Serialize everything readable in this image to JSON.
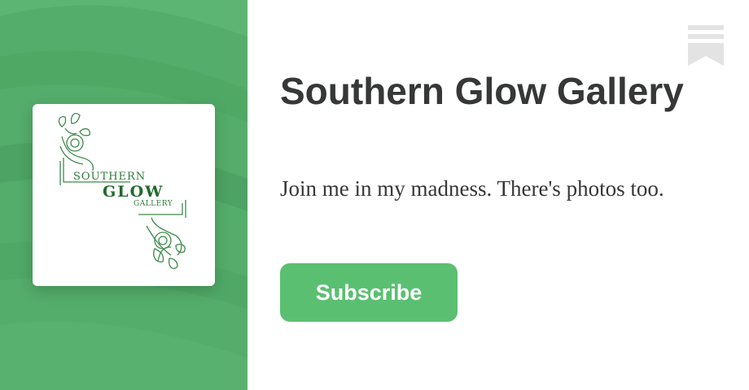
{
  "publication": {
    "title": "Southern Glow Gallery",
    "description": "Join me in my madness. There's photos too.",
    "subscribe_label": "Subscribe"
  },
  "logo": {
    "line1": "SOUTHERN",
    "line2": "GLOW",
    "line3": "GALLERY"
  },
  "icons": {
    "bookmark": "bookmark-icon"
  },
  "colors": {
    "panel": "#54ad6a",
    "accent": "#5bbf72",
    "text": "#363737",
    "bookmark": "#e3e3e3"
  }
}
